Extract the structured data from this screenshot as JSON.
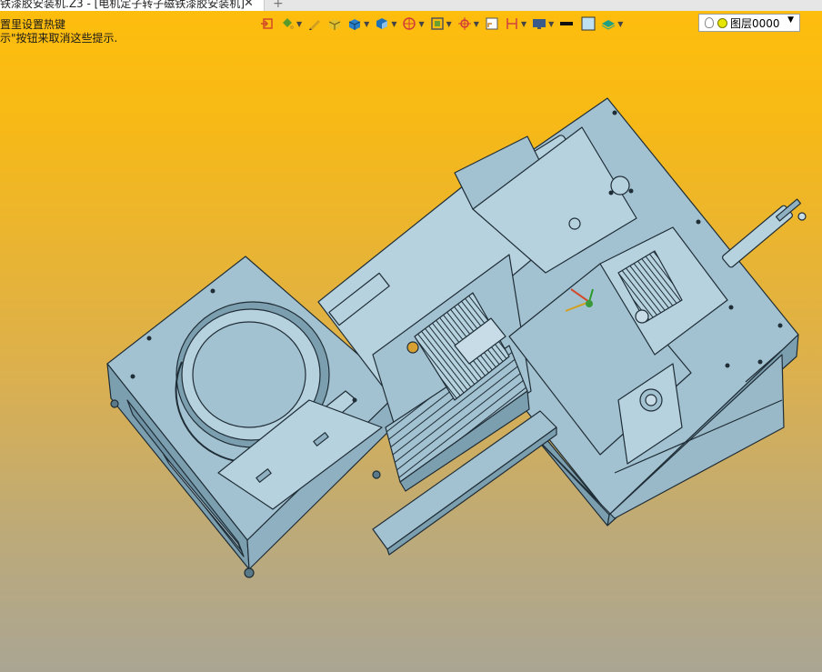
{
  "tab": {
    "title": "铁漆胶安装机.Z3 - [电机定子转子磁铁漆胶安装机]",
    "close": "✕",
    "add": "+"
  },
  "hint": {
    "line1": "置里设置热键",
    "line2": "示\"按钮来取消这些提示."
  },
  "toolbar": {
    "items": [
      {
        "icon": "exit-icon",
        "color": "#d24a2a",
        "dropdown": false
      },
      {
        "icon": "paint-bucket-icon",
        "color": "#5a9a2a",
        "dropdown": true
      },
      {
        "icon": "pencil-icon",
        "color": "#d2a020",
        "dropdown": false
      },
      {
        "icon": "box-yellow-icon",
        "color": "#e0c030",
        "dropdown": false
      },
      {
        "icon": "box-blue-icon",
        "color": "#2a80c8",
        "dropdown": true
      },
      {
        "icon": "shaded-cube-icon",
        "color": "#1e70b8",
        "dropdown": true
      },
      {
        "icon": "section-sphere-icon",
        "color": "#d23a3a",
        "dropdown": true
      },
      {
        "icon": "view-frame-icon",
        "color": "#6aa030",
        "dropdown": true
      },
      {
        "icon": "crosshair-icon",
        "color": "#d23a3a",
        "dropdown": true
      },
      {
        "icon": "sketch-plane-icon",
        "color": "#c88020",
        "dropdown": false
      },
      {
        "icon": "dimension-icon",
        "color": "#d04040",
        "dropdown": true
      },
      {
        "icon": "monitor-icon",
        "color": "#3a5a8a",
        "dropdown": true
      },
      {
        "icon": "line-weight-icon",
        "color": "#111111",
        "dropdown": false
      },
      {
        "icon": "color-swatch-icon",
        "color": "#bfe0f0",
        "dropdown": false
      },
      {
        "icon": "layers-icon",
        "color": "#20a080",
        "dropdown": true
      }
    ]
  },
  "layer_select": {
    "value": "图层0000",
    "arrow": "▼"
  },
  "colors": {
    "model_fill": "#a3c2d1",
    "model_light": "#b6d2df",
    "model_dark": "#7c9fb0",
    "edge": "#1f2d36"
  }
}
